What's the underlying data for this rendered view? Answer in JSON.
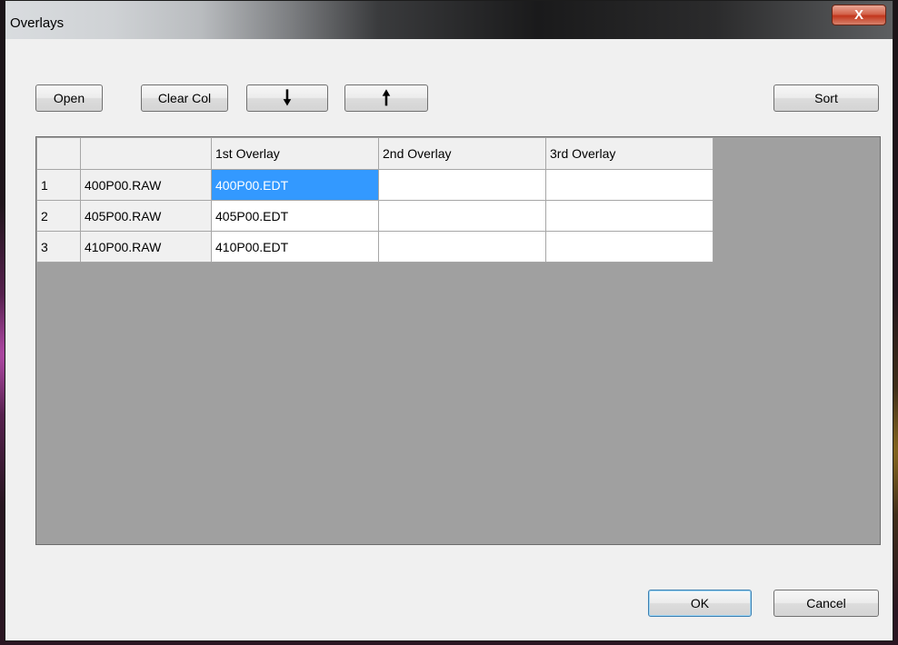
{
  "window": {
    "title": "Overlays",
    "close_glyph": "X"
  },
  "toolbar": {
    "open_label": "Open",
    "clear_col_label": "Clear Col",
    "move_down_icon": "arrow-down",
    "move_down_glyph": "🠗",
    "move_up_icon": "arrow-up",
    "move_up_glyph": "🠕",
    "sort_label": "Sort"
  },
  "grid": {
    "columns": [
      "",
      "",
      "1st Overlay",
      "2nd Overlay",
      "3rd Overlay"
    ],
    "rows": [
      {
        "num": "1",
        "raw": "400P00.RAW",
        "overlays": [
          "400P00.EDT",
          "",
          ""
        ]
      },
      {
        "num": "2",
        "raw": "405P00.RAW",
        "overlays": [
          "405P00.EDT",
          "",
          ""
        ]
      },
      {
        "num": "3",
        "raw": "410P00.RAW",
        "overlays": [
          "410P00.EDT",
          "",
          ""
        ]
      }
    ],
    "selected_cell": "row 1, 1st Overlay"
  },
  "footer": {
    "ok_label": "OK",
    "cancel_label": "Cancel"
  },
  "colors": {
    "selection": "#3399ff",
    "grid_background": "#a0a0a0",
    "close_button": "#c2361c"
  }
}
